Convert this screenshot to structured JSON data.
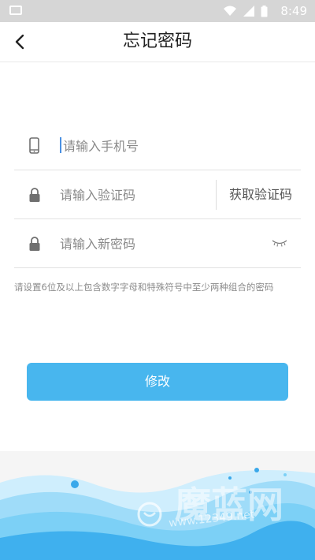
{
  "status_bar": {
    "time": "8:49"
  },
  "header": {
    "title": "忘记密码"
  },
  "form": {
    "phone": {
      "placeholder": "请输入手机号",
      "value": ""
    },
    "code": {
      "placeholder": "请输入验证码",
      "value": "",
      "get_code_label": "获取验证码"
    },
    "password": {
      "placeholder": "请输入新密码",
      "value": ""
    }
  },
  "hint": "请设置6位及以上包含数字字母和特殊符号中至少两种组合的密码",
  "submit_label": "修改",
  "watermark": {
    "brand": "魔蓝网",
    "url": "www.12349.net"
  },
  "colors": {
    "accent": "#48b6ee",
    "wave_light": "#cfeefd",
    "wave_mid": "#7cd0f6",
    "wave_dark": "#3fb0ee"
  },
  "icons": {
    "back": "chevron-left-icon",
    "phone": "smartphone-icon",
    "code": "lock-icon",
    "password": "lock-icon",
    "visibility": "eye-closed-icon"
  }
}
